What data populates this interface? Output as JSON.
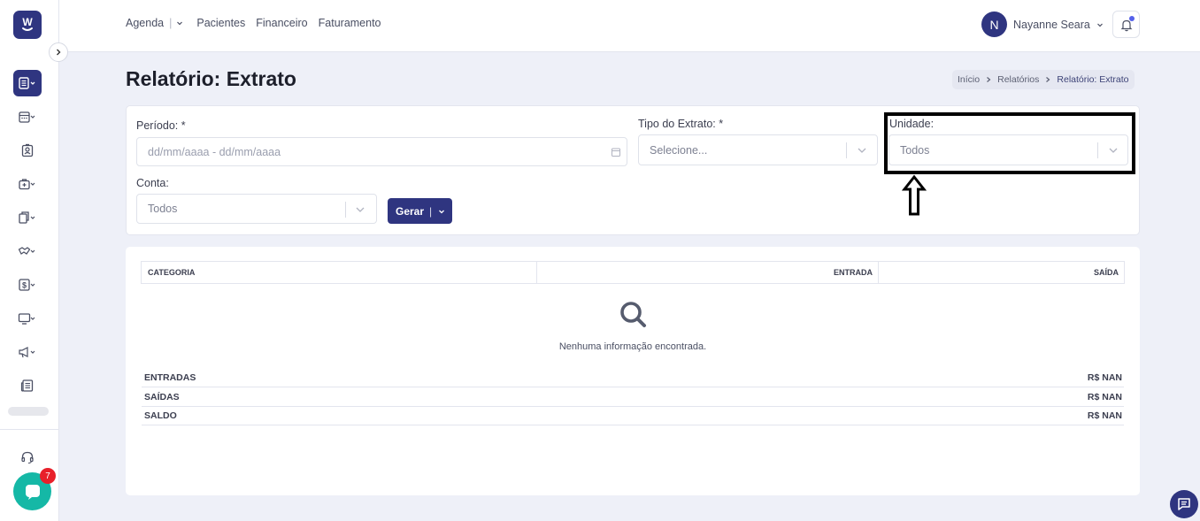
{
  "sidebar": {
    "logo_icon": "w-smile-logo",
    "collapse_icon": "chevron-right-icon",
    "items": [
      {
        "name": "reports-icon",
        "active": true
      },
      {
        "name": "calendar-icon"
      },
      {
        "name": "patient-badge-icon"
      },
      {
        "name": "medical-bag-icon"
      },
      {
        "name": "documents-icon"
      },
      {
        "name": "handshake-icon"
      },
      {
        "name": "dollar-icon"
      },
      {
        "name": "monitor-icon"
      },
      {
        "name": "megaphone-icon"
      },
      {
        "name": "newspaper-icon"
      }
    ],
    "support_icon": "headset-icon",
    "chat_badge": "7"
  },
  "topbar": {
    "nav": {
      "agenda": "Agenda",
      "agenda_sep": "|",
      "pacientes": "Pacientes",
      "financeiro": "Financeiro",
      "faturamento": "Faturamento"
    },
    "user": {
      "initial": "N",
      "name": "Nayanne Seara"
    }
  },
  "page": {
    "title": "Relatório: Extrato",
    "breadcrumb": [
      "Início",
      "Relatórios",
      "Relatório: Extrato"
    ]
  },
  "filters": {
    "periodo": {
      "label": "Período: *",
      "placeholder": "dd/mm/aaaa - dd/mm/aaaa"
    },
    "tipo": {
      "label": "Tipo do Extrato: *",
      "value": "Selecione..."
    },
    "unidade": {
      "label": "Unidade:",
      "value": "Todos"
    },
    "conta": {
      "label": "Conta:",
      "value": "Todos"
    },
    "gerar": {
      "label": "Gerar",
      "sep": "|"
    }
  },
  "table": {
    "columns": [
      "CATEGORIA",
      "ENTRADA",
      "SAÍDA"
    ],
    "empty_message": "Nenhuma informação encontrada.",
    "summary": [
      {
        "label": "ENTRADAS",
        "value": "R$ NAN"
      },
      {
        "label": "SAÍDAS",
        "value": "R$ NAN"
      },
      {
        "label": "SALDO",
        "value": "R$ NAN"
      }
    ]
  },
  "colors": {
    "primary": "#2f3580",
    "chat": "#15b8a6",
    "badge": "#e8202a"
  }
}
